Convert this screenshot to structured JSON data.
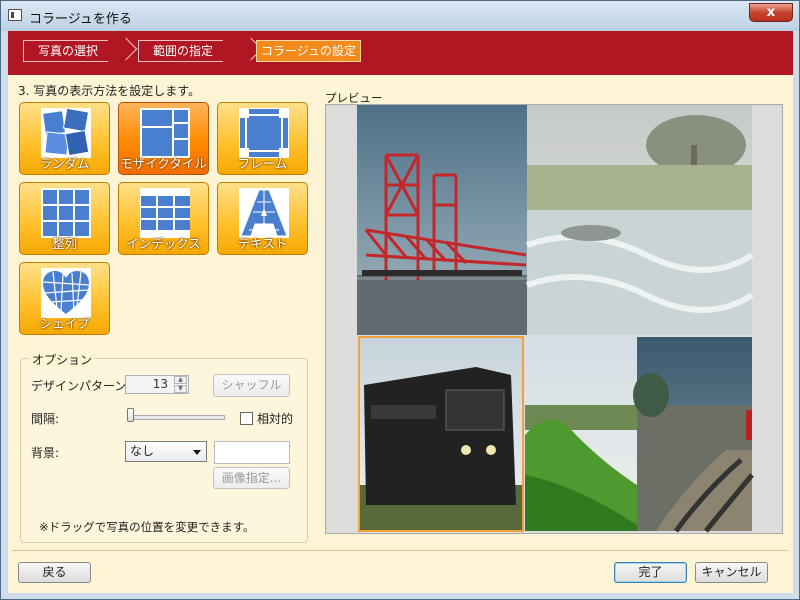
{
  "window": {
    "title": "コラージュを作る",
    "close_glyph": "x"
  },
  "wizard": {
    "steps": [
      {
        "label": "写真の選択"
      },
      {
        "label": "範囲の指定"
      },
      {
        "label": "コラージュの設定"
      }
    ],
    "active_step": 3,
    "bar_color": "#b01722",
    "active_color": "#f28a1c"
  },
  "instruction": "3. 写真の表示方法を設定します。",
  "modes": [
    {
      "label": "ランダム",
      "icon": "random-layout-icon",
      "selected": false
    },
    {
      "label": "モザイクタイル",
      "icon": "mosaic-tile-icon",
      "selected": true
    },
    {
      "label": "フレーム",
      "icon": "frame-layout-icon",
      "selected": false
    },
    {
      "label": "整列",
      "icon": "grid-layout-icon",
      "selected": false
    },
    {
      "label": "インデックス",
      "icon": "index-layout-icon",
      "selected": false
    },
    {
      "label": "テキスト",
      "icon": "text-layout-icon",
      "selected": false
    },
    {
      "label": "シェイプ",
      "icon": "shape-heart-icon",
      "selected": false
    }
  ],
  "options": {
    "legend": "オプション",
    "design_pattern_label": "デザインパターン:",
    "design_pattern_value": "13",
    "shuffle_label": "シャッフル",
    "spacing_label": "間隔:",
    "spacing_level": 0,
    "relative_label": "相対的",
    "relative_checked": false,
    "background_label": "背景:",
    "background_value": "なし",
    "image_specify_label": "画像指定...",
    "note": "※ドラッグで写真の位置を変更できます。"
  },
  "preview": {
    "label": "プレビュー",
    "photos": [
      {
        "name": "red-lift-bridge-photo"
      },
      {
        "name": "river-rapids-photo"
      },
      {
        "name": "black-train-photo"
      },
      {
        "name": "green-hill-landscape-photo"
      },
      {
        "name": "brick-pathway-photo"
      }
    ]
  },
  "footer": {
    "back": "戻る",
    "done": "完了",
    "cancel": "キャンセル"
  }
}
